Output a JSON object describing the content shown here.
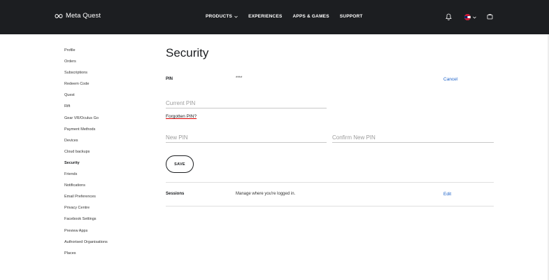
{
  "header": {
    "brand": "Meta Quest",
    "nav": [
      {
        "label": "PRODUCTS",
        "has_dropdown": true
      },
      {
        "label": "EXPERIENCES",
        "has_dropdown": false
      },
      {
        "label": "APPS & GAMES",
        "has_dropdown": false
      },
      {
        "label": "SUPPORT",
        "has_dropdown": false
      }
    ],
    "icons": [
      "bell-icon",
      "flag-icon",
      "chevron-down-icon",
      "cart-icon"
    ]
  },
  "sidebar": {
    "items": [
      {
        "label": "Profile"
      },
      {
        "label": "Orders"
      },
      {
        "label": "Subscriptions"
      },
      {
        "label": "Redeem Code"
      },
      {
        "label": "Quest"
      },
      {
        "label": "Rift"
      },
      {
        "label": "Gear VR/Oculus Go"
      },
      {
        "label": "Payment Methods"
      },
      {
        "label": "Devices"
      },
      {
        "label": "Cloud backups"
      },
      {
        "label": "Security",
        "active": true
      },
      {
        "label": "Friends"
      },
      {
        "label": "Notifications"
      },
      {
        "label": "Email Preferences"
      },
      {
        "label": "Privacy Centre"
      },
      {
        "label": "Facebook Settings"
      },
      {
        "label": "Preview Apps"
      },
      {
        "label": "Authorised Organisations"
      },
      {
        "label": "Places"
      }
    ]
  },
  "main": {
    "title": "Security",
    "pin": {
      "label": "PIN",
      "masked_value": "****",
      "cancel_label": "Cancel",
      "current_placeholder": "Current PIN",
      "forgot_label": "Forgotten PIN?",
      "new_placeholder": "New PIN",
      "confirm_placeholder": "Confirm New PIN",
      "save_label": "SAVE"
    },
    "sessions": {
      "label": "Sessions",
      "description": "Manage where you're logged in.",
      "edit_label": "Edit"
    }
  },
  "colors": {
    "header_bg": "#1c1e21",
    "link": "#1a60c8",
    "forgot_underline": "#dd0000"
  }
}
